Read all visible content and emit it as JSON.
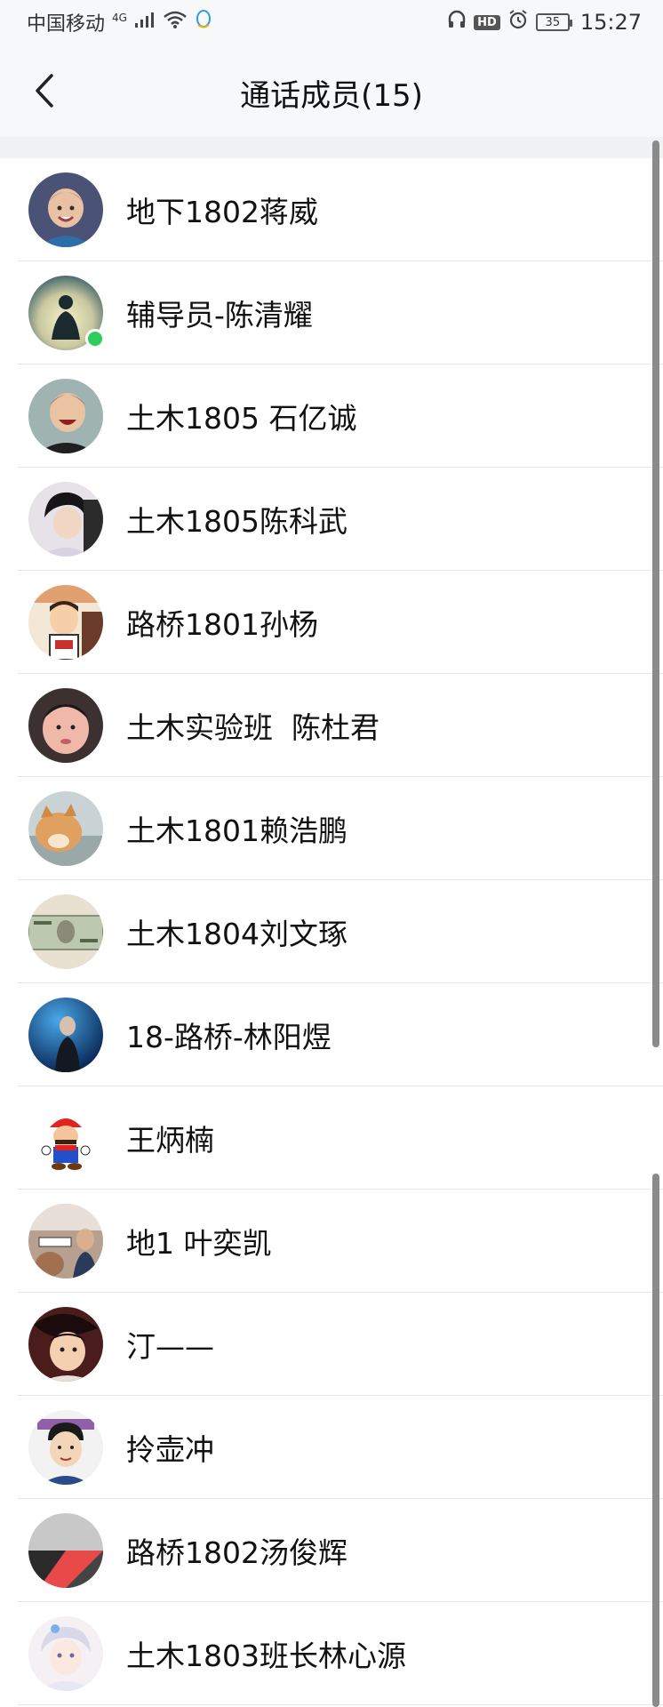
{
  "status_bar": {
    "carrier": "中国移动",
    "network": "4G",
    "battery": "35",
    "time": "15:27",
    "hd": "HD"
  },
  "header": {
    "title": "通话成员(15)"
  },
  "members": [
    {
      "name": "地下1802蒋威"
    },
    {
      "name": "辅导员-陈清耀"
    },
    {
      "name": "土木1805 石亿诚"
    },
    {
      "name": "土木1805陈科武"
    },
    {
      "name": "路桥1801孙杨"
    },
    {
      "name": "土木实验班  陈杜君"
    },
    {
      "name": "土木1801赖浩鹏"
    },
    {
      "name": "土木1804刘文琢"
    },
    {
      "name": "18-路桥-林阳煜"
    },
    {
      "name": "王炳楠"
    },
    {
      "name": "地1 叶奕凯"
    },
    {
      "name": "汀——"
    },
    {
      "name": "拎壶冲"
    },
    {
      "name": "路桥1802汤俊辉"
    },
    {
      "name": "土木1803班长林心源"
    }
  ],
  "colors": {
    "accent": "#2ecc58",
    "background": "#ffffff",
    "header_bg": "#f7f8fa",
    "divider": "#e6e6e6"
  }
}
